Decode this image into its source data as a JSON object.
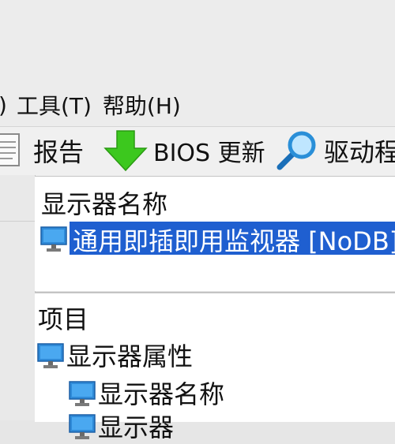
{
  "menu": {
    "paren_fragment": ")",
    "tools": "工具(T)",
    "help": "帮助(H)"
  },
  "toolbar": {
    "report": "报告",
    "bios_update": "BIOS 更新",
    "driver": "驱动程"
  },
  "top_panel": {
    "header": "显示器名称",
    "selected_item": "通用即插即用监视器 [NoDB]"
  },
  "bottom_panel": {
    "header": "项目",
    "tree": [
      {
        "label": "显示器属性",
        "level": 1
      },
      {
        "label": "显示器名称",
        "level": 2
      },
      {
        "label": "显示器",
        "level": 2
      }
    ]
  },
  "colors": {
    "selection": "#1f5fd0",
    "arrow_green": "#3cc81e",
    "magnifier_blue": "#2a8fd8"
  },
  "icons": [
    "document-icon",
    "download-arrow-icon",
    "magnifier-icon",
    "monitor-icon"
  ]
}
